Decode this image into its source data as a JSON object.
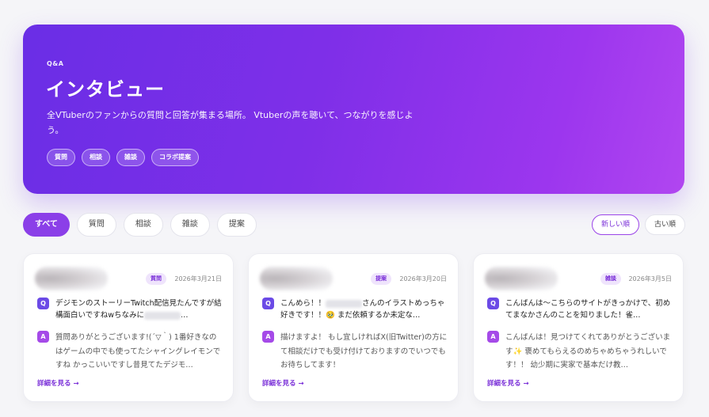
{
  "hero": {
    "eyebrow": "Q&A",
    "title": "インタビュー",
    "description": "全VTuberのファンからの質問と回答が集まる場所。 Vtuberの声を聴いて、つながりを感じよう。",
    "tags": [
      "質問",
      "相談",
      "雑談",
      "コラボ提案"
    ]
  },
  "filters": [
    "すべて",
    "質問",
    "相談",
    "雑談",
    "提案"
  ],
  "active_filter": "すべて",
  "sort": {
    "newest": "新しい順",
    "oldest": "古い順"
  },
  "cards": [
    {
      "badge": "質問",
      "date": "2026年3月21日",
      "q_label": "Q",
      "a_label": "A",
      "question_before": "デジモンのストーリーTwitch配信見たんですが結構面白いですねwちなみに",
      "question_after": "…",
      "answer": "質問ありがとうございます!(´▽｀) 1番好きなのはゲームの中でも使ってたシャイングレイモンですね かっこいいですし昔見てたデジモ…",
      "detail": "詳細を見る →"
    },
    {
      "badge": "提案",
      "date": "2026年3月20日",
      "q_label": "Q",
      "a_label": "A",
      "question_before": "こんめら！！",
      "question_after": "さんのイラストめっちゃ好きです！！🥹 まだ依頼するか未定な…",
      "answer": "描けますよ！ もし宜しければX(旧Twitter)の方にて相談だけでも受け付けておりますのでいつでもお待ちしてます！",
      "detail": "詳細を見る →"
    },
    {
      "badge": "雑談",
      "date": "2026年3月5日",
      "q_label": "Q",
      "a_label": "A",
      "question_before": "こんばんは〜こちらのサイトがきっかけで、初めてまなかさんのことを知りました！雀…",
      "question_after": "",
      "answer": "こんばんは！見つけてくれてありがとうございます✨ 褒めてもらえるのめちゃめちゃうれしいです！！ 幼少期に実家で基本だけ教…",
      "detail": "詳細を見る →"
    }
  ]
}
